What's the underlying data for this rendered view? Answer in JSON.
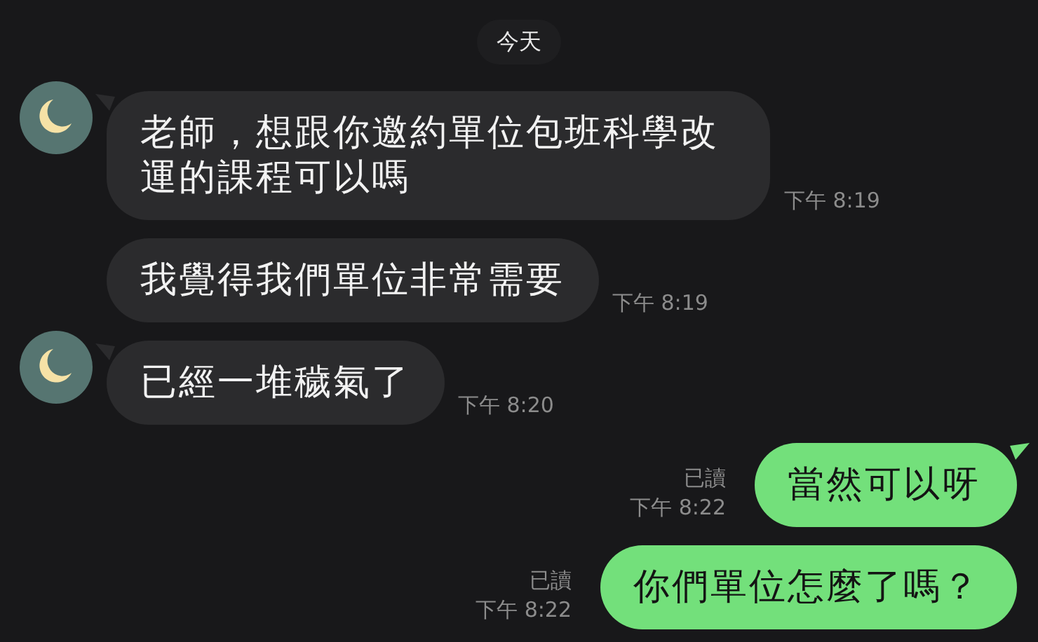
{
  "date_label": "今天",
  "messages": [
    {
      "kind": "incoming",
      "tail": true,
      "text": "老師，想跟你邀約單位包班科學改運的課程可以嗎",
      "time": "下午 8:19"
    },
    {
      "kind": "incoming",
      "tail": false,
      "text": "我覺得我們單位非常需要",
      "time": "下午 8:19"
    },
    {
      "kind": "incoming",
      "tail": true,
      "text": "已經一堆穢氣了",
      "time": "下午 8:20"
    },
    {
      "kind": "outgoing",
      "tail": true,
      "read": "已讀",
      "text": "當然可以呀",
      "time": "下午 8:22"
    },
    {
      "kind": "outgoing",
      "tail": false,
      "read": "已讀",
      "text": "你們單位怎麼了嗎？",
      "time": "下午 8:22"
    }
  ]
}
